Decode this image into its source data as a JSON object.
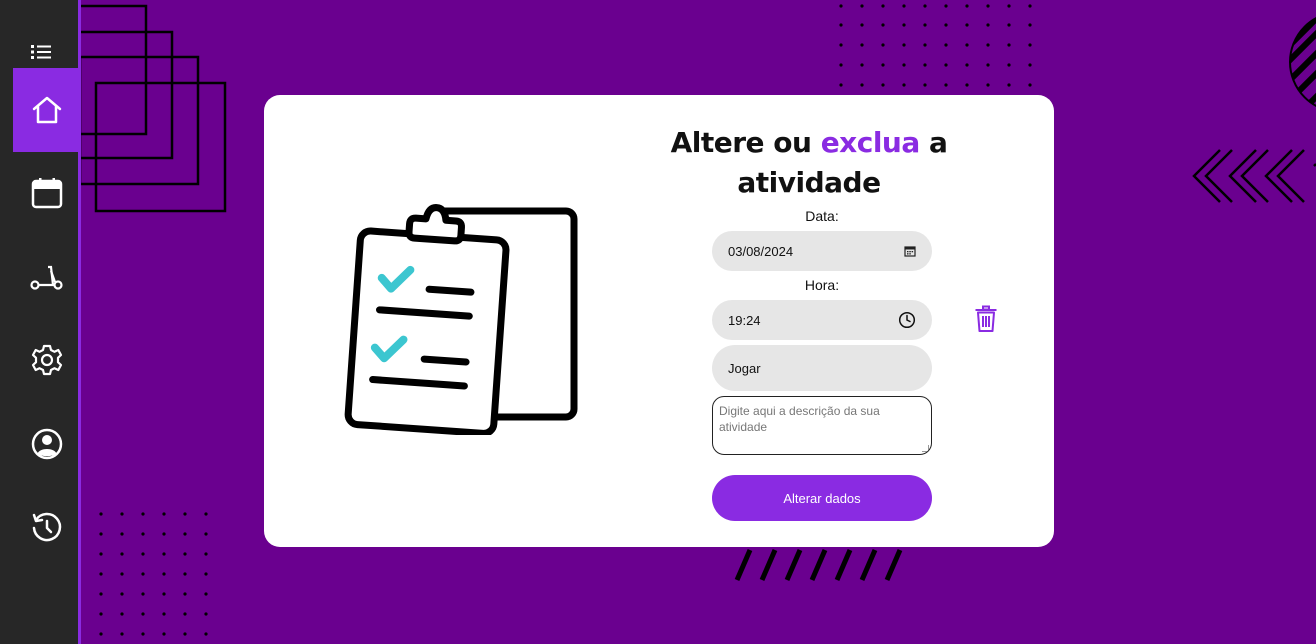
{
  "colors": {
    "background": "#6a008f",
    "sidebar": "#272727",
    "accent": "#8a2be2",
    "card": "#ffffff",
    "input": "#e6e6e6",
    "check": "#3cc6d0"
  },
  "sidebar": {
    "items": [
      {
        "icon": "menu-icon",
        "active": false
      },
      {
        "icon": "home-icon",
        "active": true
      },
      {
        "icon": "calendar-icon",
        "active": false
      },
      {
        "icon": "scooter-icon",
        "active": false
      },
      {
        "icon": "gear-icon",
        "active": false
      },
      {
        "icon": "user-icon",
        "active": false
      },
      {
        "icon": "history-icon",
        "active": false
      }
    ]
  },
  "form": {
    "title_part1": "Altere ou ",
    "title_accent": "exclua",
    "title_part2": " a atividade",
    "date_label": "Data:",
    "date_value": "03/08/2024",
    "time_label": "Hora:",
    "time_value": "19:24",
    "activity_value": "Jogar",
    "description_placeholder": "Digite aqui a descrição da sua atividade",
    "submit_label": "Alterar dados"
  }
}
